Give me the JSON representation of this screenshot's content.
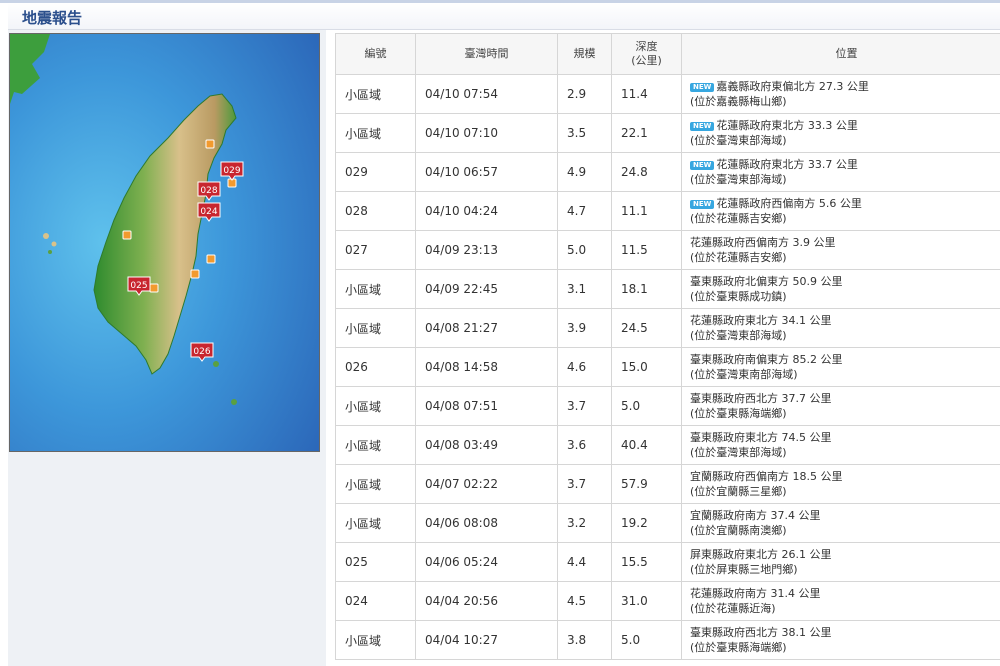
{
  "header": {
    "title": "地震報告"
  },
  "table": {
    "headers": {
      "id": "編號",
      "time": "臺灣時間",
      "magnitude": "規模",
      "depth_line1": "深度",
      "depth_line2": "(公里)",
      "location": "位置"
    },
    "new_tag": "NEW",
    "rows": [
      {
        "id": "小區域",
        "time": "04/10 07:54",
        "magnitude": "2.9",
        "depth": "11.4",
        "loc1": "嘉義縣政府東偏北方 27.3 公里",
        "loc2": "(位於嘉義縣梅山鄉)",
        "new": true
      },
      {
        "id": "小區域",
        "time": "04/10 07:10",
        "magnitude": "3.5",
        "depth": "22.1",
        "loc1": "花蓮縣政府東北方 33.3 公里",
        "loc2": "(位於臺灣東部海域)",
        "new": true
      },
      {
        "id": "029",
        "time": "04/10 06:57",
        "magnitude": "4.9",
        "depth": "24.8",
        "loc1": "花蓮縣政府東北方 33.7 公里",
        "loc2": "(位於臺灣東部海域)",
        "new": true
      },
      {
        "id": "028",
        "time": "04/10 04:24",
        "magnitude": "4.7",
        "depth": "11.1",
        "loc1": "花蓮縣政府西偏南方 5.6 公里",
        "loc2": "(位於花蓮縣吉安鄉)",
        "new": true
      },
      {
        "id": "027",
        "time": "04/09 23:13",
        "magnitude": "5.0",
        "depth": "11.5",
        "loc1": "花蓮縣政府西偏南方 3.9 公里",
        "loc2": "(位於花蓮縣吉安鄉)",
        "new": false
      },
      {
        "id": "小區域",
        "time": "04/09 22:45",
        "magnitude": "3.1",
        "depth": "18.1",
        "loc1": "臺東縣政府北偏東方 50.9 公里",
        "loc2": "(位於臺東縣成功鎮)",
        "new": false
      },
      {
        "id": "小區域",
        "time": "04/08 21:27",
        "magnitude": "3.9",
        "depth": "24.5",
        "loc1": "花蓮縣政府東北方 34.1 公里",
        "loc2": "(位於臺灣東部海域)",
        "new": false
      },
      {
        "id": "026",
        "time": "04/08 14:58",
        "magnitude": "4.6",
        "depth": "15.0",
        "loc1": "臺東縣政府南偏東方 85.2 公里",
        "loc2": "(位於臺灣東南部海域)",
        "new": false
      },
      {
        "id": "小區域",
        "time": "04/08 07:51",
        "magnitude": "3.7",
        "depth": "5.0",
        "loc1": "臺東縣政府西北方 37.7 公里",
        "loc2": "(位於臺東縣海端鄉)",
        "new": false
      },
      {
        "id": "小區域",
        "time": "04/08 03:49",
        "magnitude": "3.6",
        "depth": "40.4",
        "loc1": "臺東縣政府東北方 74.5 公里",
        "loc2": "(位於臺灣東部海域)",
        "new": false
      },
      {
        "id": "小區域",
        "time": "04/07 02:22",
        "magnitude": "3.7",
        "depth": "57.9",
        "loc1": "宜蘭縣政府西偏南方 18.5 公里",
        "loc2": "(位於宜蘭縣三星鄉)",
        "new": false
      },
      {
        "id": "小區域",
        "time": "04/06 08:08",
        "magnitude": "3.2",
        "depth": "19.2",
        "loc1": "宜蘭縣政府南方 37.4 公里",
        "loc2": "(位於宜蘭縣南澳鄉)",
        "new": false
      },
      {
        "id": "025",
        "time": "04/06 05:24",
        "magnitude": "4.4",
        "depth": "15.5",
        "loc1": "屏東縣政府東北方 26.1 公里",
        "loc2": "(位於屏東縣三地門鄉)",
        "new": false
      },
      {
        "id": "024",
        "time": "04/04 20:56",
        "magnitude": "4.5",
        "depth": "31.0",
        "loc1": "花蓮縣政府南方 31.4 公里",
        "loc2": "(位於花蓮縣近海)",
        "new": false
      },
      {
        "id": "小區域",
        "time": "04/04 10:27",
        "magnitude": "3.8",
        "depth": "5.0",
        "loc1": "臺東縣政府西北方 38.1 公里",
        "loc2": "(位於臺東縣海端鄉)",
        "new": false
      }
    ]
  },
  "map": {
    "markers": [
      {
        "label": "029"
      },
      {
        "label": "028"
      },
      {
        "label": "024"
      },
      {
        "label": "025"
      },
      {
        "label": "026"
      }
    ],
    "colors": {
      "sea": "#3f8fd6",
      "land_low": "#3a9c3a",
      "land_high": "#d9c28a",
      "marker": "#c8262f",
      "minor_marker": "#f29a2e"
    }
  }
}
